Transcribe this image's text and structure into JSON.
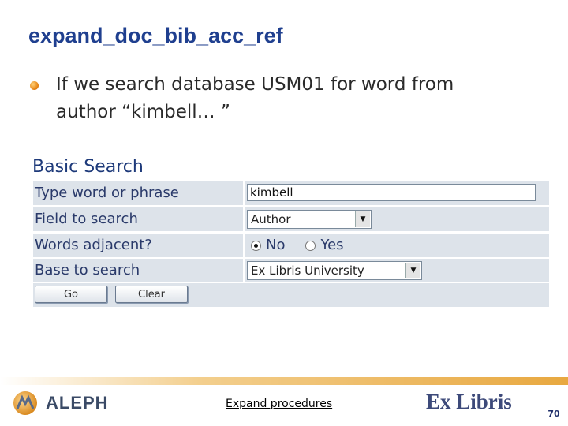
{
  "slide": {
    "title": "expand_doc_bib_acc_ref",
    "bullet": "If we search database USM01 for word from\nauthor “kimbell… ”"
  },
  "search_form": {
    "title": "Basic Search",
    "word_label": "Type word or phrase",
    "word_value": "kimbell",
    "field_label": "Field to search",
    "field_value": "Author",
    "adjacent_label": "Words adjacent?",
    "adjacent_options": [
      "No",
      "Yes"
    ],
    "adjacent_selected": "No",
    "base_label": "Base to search",
    "base_value": "Ex Libris University",
    "go_label": "Go",
    "clear_label": "Clear"
  },
  "footer": {
    "aleph_logo_text": "ALEPH",
    "link": "Expand procedures",
    "exlibris_logo_text": "Ex Libris",
    "page_number": "70"
  },
  "colors": {
    "title": "#1f3f8f",
    "row_background": "#dde3ea",
    "bullet": "#e8891a",
    "footer_band": "#e8a840"
  },
  "icons": [
    "bullet-dot-icon",
    "dropdown-arrow-icon",
    "radio-icon",
    "aleph-logo-icon"
  ]
}
